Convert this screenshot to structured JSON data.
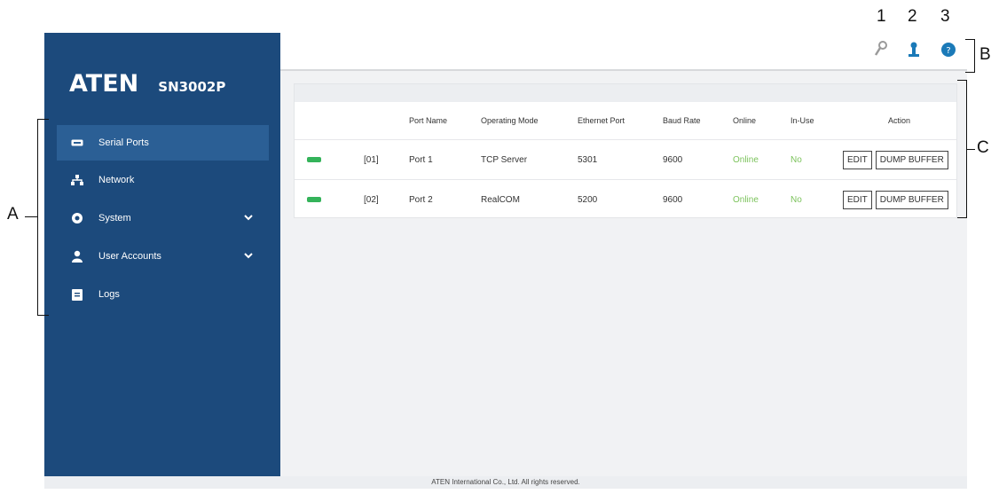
{
  "brand": {
    "logo": "ATEN",
    "model": "SN3002P"
  },
  "sidebar": {
    "items": [
      {
        "label": "Serial Ports",
        "icon": "serial-port-icon",
        "active": true
      },
      {
        "label": "Network",
        "icon": "network-icon",
        "active": false
      },
      {
        "label": "System",
        "icon": "gear-icon",
        "active": false,
        "expandable": true
      },
      {
        "label": "User Accounts",
        "icon": "user-icon",
        "active": false,
        "expandable": true
      },
      {
        "label": "Logs",
        "icon": "logs-icon",
        "active": false
      }
    ]
  },
  "toolbar": {
    "icons": [
      "wrench-icon",
      "user-icon",
      "help-icon"
    ],
    "callouts": [
      "1",
      "2",
      "3"
    ]
  },
  "table": {
    "headers": [
      "Port Name",
      "Operating Mode",
      "Ethernet Port",
      "Baud Rate",
      "Online",
      "In-Use",
      "Action"
    ],
    "rows": [
      {
        "index": "[01]",
        "name": "Port 1",
        "mode": "TCP Server",
        "eth": "5301",
        "baud": "9600",
        "online": "Online",
        "inuse": "No"
      },
      {
        "index": "[02]",
        "name": "Port 2",
        "mode": "RealCOM",
        "eth": "5200",
        "baud": "9600",
        "online": "Online",
        "inuse": "No"
      }
    ],
    "edit_label": "EDIT",
    "dump_label": "DUMP BUFFER"
  },
  "footer": "ATEN International Co., Ltd. All rights reserved.",
  "annotations": {
    "a": "A",
    "b": "B",
    "c": "C"
  },
  "colors": {
    "sidebar": "#1c4a7c",
    "active": "#2b5f95",
    "led": "#34b35a",
    "online": "#7cc35c",
    "help": "#1b7ab8"
  }
}
